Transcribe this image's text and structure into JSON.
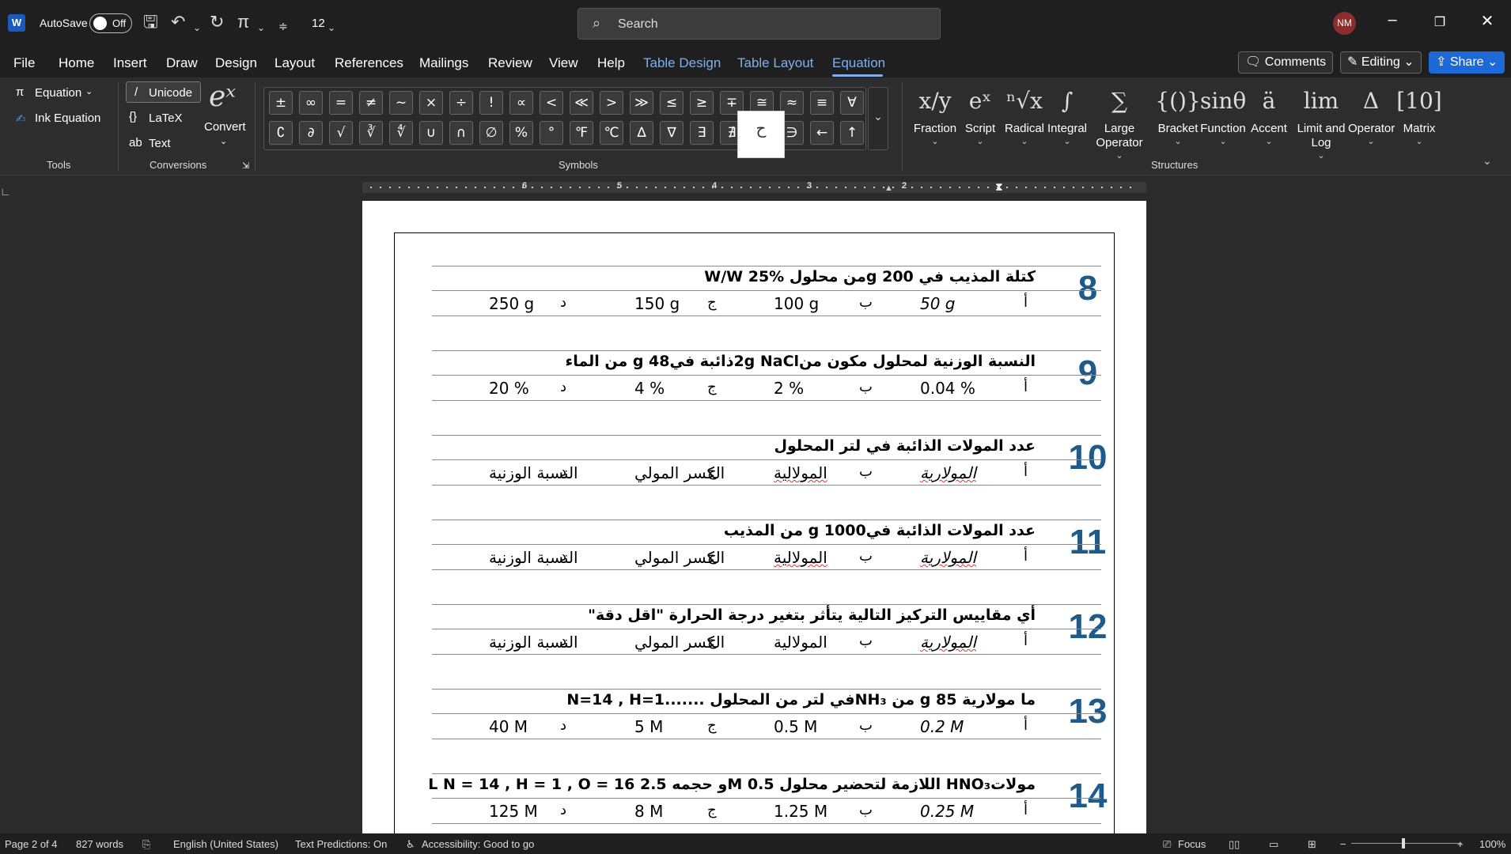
{
  "titlebar": {
    "autosave_label": "AutoSave",
    "autosave_state": "Off",
    "font_size": "12",
    "search_placeholder": "Search",
    "user_initials": "NM"
  },
  "menu": {
    "tabs": [
      "File",
      "Home",
      "Insert",
      "Draw",
      "Design",
      "Layout",
      "References",
      "Mailings",
      "Review",
      "View",
      "Help"
    ],
    "contextual_tabs": [
      "Table Design",
      "Table Layout"
    ],
    "active_tab": "Equation",
    "comments": "Comments",
    "editing": "Editing",
    "share": "Share"
  },
  "ribbon": {
    "tools": {
      "equation": "Equation",
      "ink_equation": "Ink Equation",
      "label": "Tools"
    },
    "conversions": {
      "unicode": "Unicode",
      "latex": "LaTeX",
      "text": "Text",
      "convert": "Convert",
      "label": "Conversions"
    },
    "symbols": {
      "label": "Symbols",
      "row1": [
        "±",
        "∞",
        "=",
        "≠",
        "~",
        "×",
        "÷",
        "!",
        "∝",
        "<",
        "≪",
        ">",
        "≫",
        "≤",
        "≥",
        "∓",
        "≅",
        "≈",
        "≡",
        "∀"
      ],
      "row2": [
        "∁",
        "∂",
        "√",
        "∛",
        "∜",
        "∪",
        "∩",
        "∅",
        "%",
        "°",
        "℉",
        "℃",
        "∆",
        "∇",
        "∃",
        "∄",
        "∈",
        "∋",
        "←",
        "↑"
      ],
      "tooltip": "ح"
    },
    "structures": {
      "label": "Structures",
      "items": [
        {
          "glyph": "x/y",
          "label": "Fraction"
        },
        {
          "glyph": "eˣ",
          "label": "Script"
        },
        {
          "glyph": "ⁿ√x",
          "label": "Radical"
        },
        {
          "glyph": "∫",
          "label": "Integral"
        },
        {
          "glyph": "∑",
          "label": "Large Operator"
        },
        {
          "glyph": "{()}",
          "label": "Bracket"
        },
        {
          "glyph": "sinθ",
          "label": "Function"
        },
        {
          "glyph": "ä",
          "label": "Accent"
        },
        {
          "glyph": "lim",
          "label": "Limit and Log"
        },
        {
          "glyph": "Δ",
          "label": "Operator"
        },
        {
          "glyph": "[10]",
          "label": "Matrix"
        }
      ]
    }
  },
  "ruler": {
    "numbers": [
      "6",
      "5",
      "4",
      "3",
      "2"
    ]
  },
  "questions": [
    {
      "num": "8",
      "text": "كتلة المذيب في g 200من محلول W/W 25%",
      "answers": [
        "أ",
        "50 g",
        "ب",
        "100 g",
        "ج",
        "150 g",
        "د",
        "250 g"
      ]
    },
    {
      "num": "9",
      "text": "النسبة الوزنية لمحلول مكون من2g NaClذائبة فيg 48 من الماء",
      "answers": [
        "أ",
        "0.04 %",
        "ب",
        "2 %",
        "ج",
        "4 %",
        "د",
        "20 %"
      ]
    },
    {
      "num": "10",
      "text": "عدد المولات الذائبة في لتر المحلول",
      "answers": [
        "أ",
        "المولارية",
        "ب",
        "المولالية",
        "ج",
        "الكسر المولي",
        "د",
        "النسبة الوزنية"
      ]
    },
    {
      "num": "11",
      "text": "عدد المولات الذائبة فيg 1000 من المذيب",
      "answers": [
        "أ",
        "المولارية",
        "ب",
        "المولالية",
        "ج",
        "الكسر المولي",
        "د",
        "النسبة الوزنية"
      ]
    },
    {
      "num": "12",
      "text": "أي مقاييس التركيز التالية يتأثر بتغير درجة الحرارة \"اقل دقة\"",
      "answers": [
        "أ",
        "المولارية",
        "ب",
        "المولالية",
        "ج",
        "الكسر المولي",
        "د",
        "النسبة الوزنية"
      ]
    },
    {
      "num": "13",
      "text": "ما مولارية g 85 من NH₃في لتر من المحلول .......N=14 , H=1",
      "answers": [
        "أ",
        "0.2 M",
        "ب",
        "0.5 M",
        "ج",
        "5 M",
        "د",
        "40 M"
      ]
    },
    {
      "num": "14",
      "text": "مولاتHNO₃ اللازمة لتحضير محلول 0.5 Mو حجمه 2.5 L   N = 14 , H = 1 , O = 16",
      "answers": [
        "أ",
        "0.25 M",
        "ب",
        "1.25 M",
        "ج",
        "8 M",
        "د",
        "125 M"
      ]
    }
  ],
  "status": {
    "page": "Page 2 of 4",
    "words": "827 words",
    "language": "English (United States)",
    "predictions": "Text Predictions: On",
    "accessibility": "Accessibility: Good to go",
    "focus": "Focus",
    "zoom": "100%"
  }
}
